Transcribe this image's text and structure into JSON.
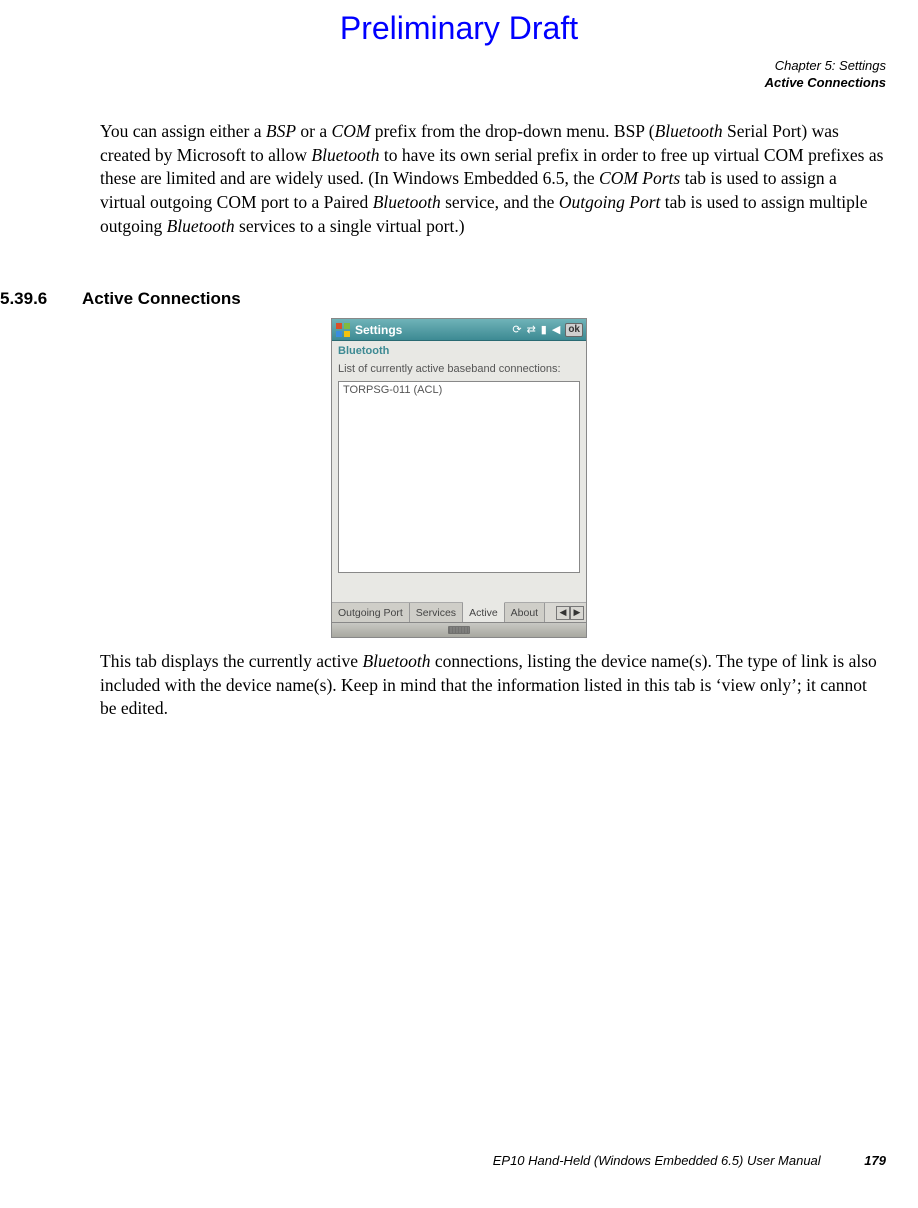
{
  "watermark": "Preliminary Draft",
  "header": {
    "chapter": "Chapter 5:  Settings",
    "section": "Active Connections"
  },
  "paragraph1": {
    "t1": "You can assign either a ",
    "i1": "BSP",
    "t2": " or a ",
    "i2": "COM",
    "t3": " prefix from the drop-down menu. BSP (",
    "i3": "Bluetooth",
    "t4": " Serial Port) was created by Microsoft to allow ",
    "i4": "Bluetooth",
    "t5": " to have its own serial prefix in order to free up virtual COM prefixes as these are limited and are widely used. (In Windows Embedded 6.5, the ",
    "i5": "COM Ports",
    "t6": " tab is used to assign a virtual outgoing COM port to a Paired ",
    "i6": "Bluetooth",
    "t7": " service, and the ",
    "i7": "Outgoing Port",
    "t8": " tab is used to assign multiple outgoing ",
    "i8": "Bluetooth",
    "t9": " services to a single virtual port.)"
  },
  "section": {
    "number": "5.39.6",
    "title": "Active Connections"
  },
  "screenshot": {
    "titlebar_title": "Settings",
    "ok_label": "ok",
    "bluetooth_label": "Bluetooth",
    "caption": "List of currently active baseband connections:",
    "items": [
      "TORPSG-011 (ACL)"
    ],
    "tabs": [
      "Outgoing Port",
      "Services",
      "Active",
      "About"
    ],
    "active_tab_index": 2
  },
  "paragraph2": {
    "t1": "This tab displays the currently active ",
    "i1": "Bluetooth",
    "t2": " connections, listing the device name(s). The type of link is also included with the device name(s). Keep in mind that the information listed in this tab is ‘view only’; it cannot be edited."
  },
  "footer": {
    "manual": "EP10 Hand-Held (Windows Embedded 6.5) User Manual",
    "page": "179"
  }
}
